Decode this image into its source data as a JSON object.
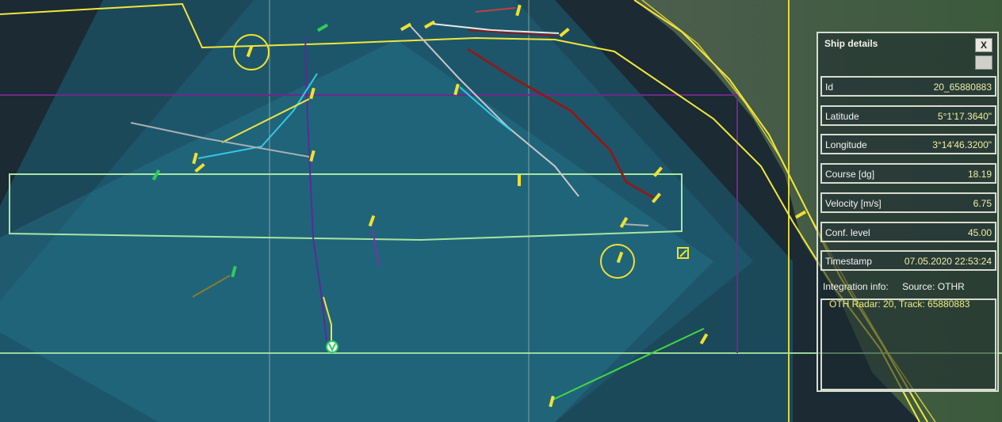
{
  "colors": {
    "sea": "#1b2a33",
    "coverage": "#1f6f8a",
    "coast": "#f2e63a",
    "grid": "#c9d0c0",
    "zone": "#a8e6a0",
    "purple": "#6b2a8a",
    "ship": "#f0e030",
    "ship_green": "#2ecc5a"
  },
  "panel": {
    "title": "Ship details",
    "close_label": "X",
    "fields": [
      {
        "label": "Id",
        "value": "20_65880883"
      },
      {
        "label": "Latitude",
        "value": "5°1'17.3640\""
      },
      {
        "label": "Longitude",
        "value": "3°14'46.3200\""
      },
      {
        "label": "Course [dg]",
        "value": "18.19"
      },
      {
        "label": "Velocity [m/s]",
        "value": "6.75"
      },
      {
        "label": "Conf. level",
        "value": "45.00"
      },
      {
        "label": "Timestamp",
        "value": "07.05.2020 22:53:24"
      }
    ],
    "integration_label": "Integration info:",
    "source_label": "Source:",
    "source_value": "OTHR",
    "integration_detail": "OTH Radar: 20, Track: 65880883"
  }
}
